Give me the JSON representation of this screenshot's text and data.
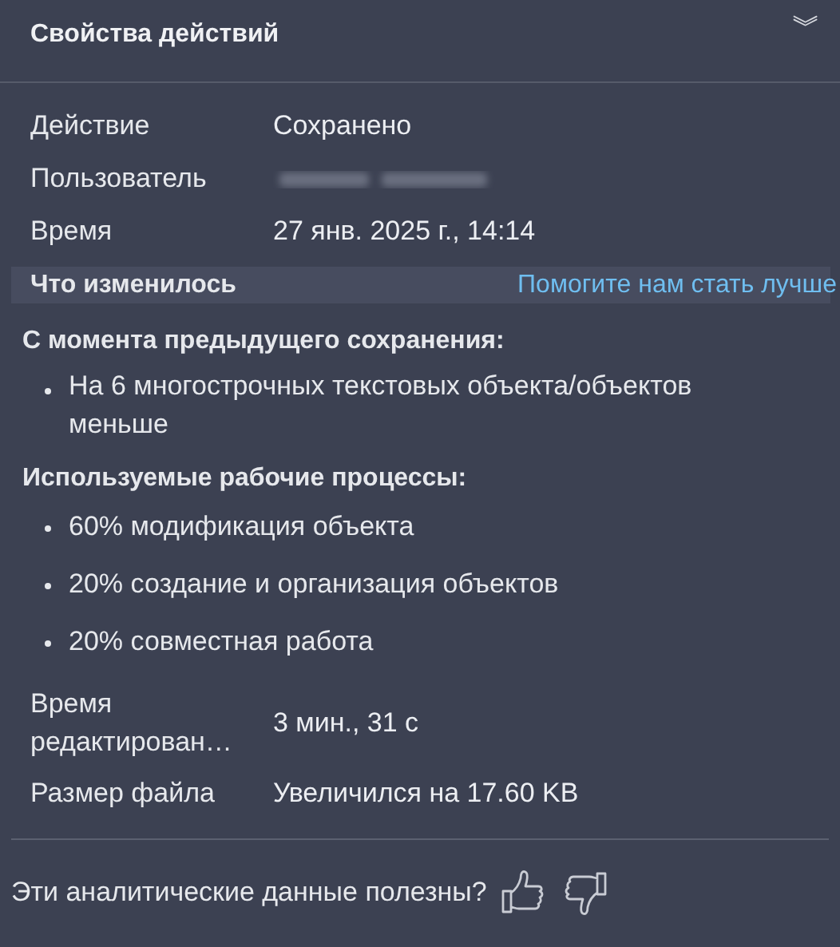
{
  "panel": {
    "title": "Свойства действий",
    "collapse_glyph": "︾"
  },
  "properties": [
    {
      "label": "Действие",
      "value": "Сохранено",
      "kind": "text"
    },
    {
      "label": "Пользователь",
      "kind": "redacted"
    },
    {
      "label": "Время",
      "value": "27 янв. 2025 г., 14:14",
      "kind": "text"
    }
  ],
  "changes": {
    "title": "Что изменилось",
    "help_link": "Помогите нам стать лучше",
    "groups": [
      {
        "heading": "С момента предыдущего сохранения:",
        "items": [
          "На 6 многострочных текстовых объекта/объектов меньше"
        ]
      },
      {
        "heading": "Используемые рабочие процессы:",
        "items": [
          "60% модификация объекта",
          "20% создание и организация объектов",
          "20% совместная работа"
        ]
      }
    ]
  },
  "stats": [
    {
      "label": "Время редактирован…",
      "value": "3 мин., 31 с"
    },
    {
      "label": "Размер файла",
      "value": "Увеличился на 17.60 KB"
    }
  ],
  "feedback": {
    "question": "Эти аналитические данные полезны?"
  }
}
